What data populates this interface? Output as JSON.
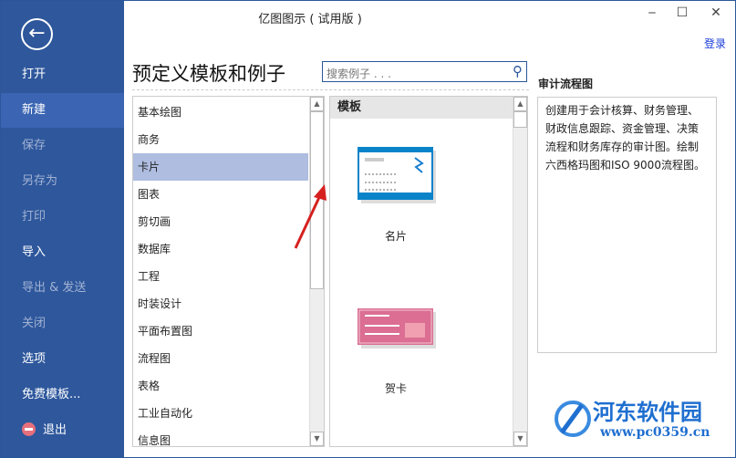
{
  "window": {
    "title": "亿图图示 ( 试用版 )",
    "minimize": "‒",
    "maximize": "☐",
    "close": "✕",
    "login": "登录"
  },
  "sidebar": {
    "back_icon": "arrow-left-circle",
    "items": [
      {
        "label": "打开",
        "enabled": true
      },
      {
        "label": "新建",
        "enabled": true,
        "selected": true
      },
      {
        "label": "保存",
        "enabled": false
      },
      {
        "label": "另存为",
        "enabled": false
      },
      {
        "label": "打印",
        "enabled": false
      },
      {
        "label": "导入",
        "enabled": true
      },
      {
        "label": "导出 & 发送",
        "enabled": false
      },
      {
        "label": "关闭",
        "enabled": false
      },
      {
        "label": "选项",
        "enabled": true
      },
      {
        "label": "免费模板...",
        "enabled": true
      },
      {
        "label": "退出",
        "enabled": true
      }
    ]
  },
  "main": {
    "heading": "预定义模板和例子",
    "search_placeholder": "搜索例子 . . .",
    "categories": [
      "基本绘图",
      "商务",
      "卡片",
      "图表",
      "剪切画",
      "数据库",
      "工程",
      "时装设计",
      "平面布置图",
      "流程图",
      "表格",
      "工业自动化",
      "信息图"
    ],
    "selected_category": "卡片",
    "templates_header": "模板",
    "templates": [
      {
        "label": "名片"
      },
      {
        "label": "贺卡"
      }
    ]
  },
  "detail": {
    "title": "审计流程图",
    "description": "创建用于会计核算、财务管理、财政信息跟踪、资金管理、决策流程和财务库存的审计图。绘制六西格玛图和ISO 9000流程图。"
  },
  "watermark": {
    "name": "河东软件园",
    "url": "www.pc0359.cn"
  },
  "colors": {
    "sidebar": "#2e579c",
    "selected": "#aebde0",
    "accent": "#2b579a"
  }
}
